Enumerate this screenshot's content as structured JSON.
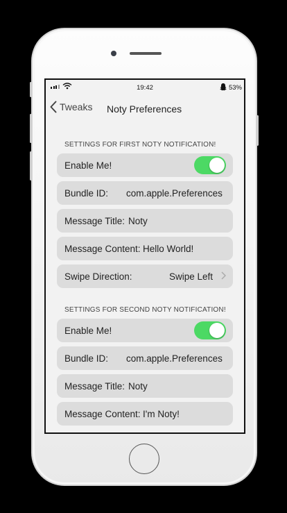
{
  "status_bar": {
    "time": "19:42",
    "battery": "53%"
  },
  "nav": {
    "back_label": "Tweaks",
    "title": "Noty Preferences"
  },
  "sections": [
    {
      "header": "SETTINGS FOR FIRST NOTY NOTIFICATION!",
      "enable_label": "Enable Me!",
      "enabled": true,
      "bundle_label": "Bundle ID:",
      "bundle_value": "com.apple.Preferences",
      "title_label": "Message Title:",
      "title_value": "Noty",
      "content_label": "Message Content:",
      "content_value": "Hello World!",
      "swipe_label": "Swipe Direction:",
      "swipe_value": "Swipe Left"
    },
    {
      "header": "SETTINGS FOR SECOND NOTY NOTIFICATION!",
      "enable_label": "Enable Me!",
      "enabled": true,
      "bundle_label": "Bundle ID:",
      "bundle_value": "com.apple.Preferences",
      "title_label": "Message Title:",
      "title_value": "Noty",
      "content_label": "Message Content:",
      "content_value": "I'm Noty!"
    }
  ],
  "colors": {
    "toggle_on": "#4cd964",
    "row_bg": "#dcdcdc",
    "screen_bg": "#f2f2f2"
  }
}
